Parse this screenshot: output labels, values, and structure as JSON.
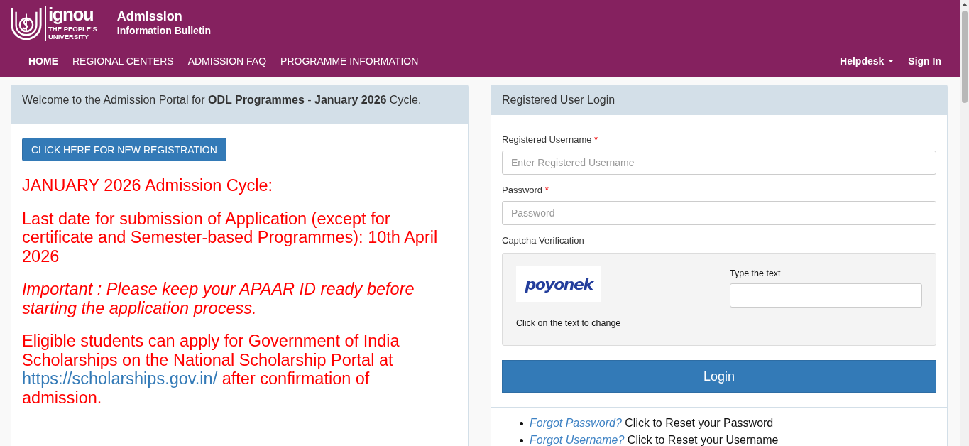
{
  "header": {
    "logo": {
      "wordmark": "ignou",
      "tagline": [
        "THE PEOPLE'S",
        "UNIVERSITY"
      ]
    },
    "title": "Admission",
    "subtitle": "Information Bulletin"
  },
  "nav": {
    "items": [
      {
        "label": "HOME",
        "selected": true
      },
      {
        "label": "REGIONAL CENTERS",
        "selected": false
      },
      {
        "label": "ADMISSION FAQ",
        "selected": false
      },
      {
        "label": "PROGRAMME INFORMATION",
        "selected": false
      }
    ],
    "right_items": [
      {
        "label": "Helpdesk",
        "kind": "dropdown"
      },
      {
        "label": "Sign In",
        "kind": "link"
      }
    ]
  },
  "welcome_panel": {
    "heading": "Welcome to the Admission Portal for **ODL Programmes** - **January 2026** Cycle.",
    "register_button": "CLICK HERE FOR NEW REGISTRATION",
    "notices": [
      {
        "kind": "plain",
        "text": "JANUARY 2026 Admission Cycle:"
      },
      {
        "kind": "plain",
        "text": "Last date for submission of Application (except for certificate and Semester-based Programmes): 10th April 2026"
      },
      {
        "kind": "italic",
        "text": "Important : Please keep your APAAR ID ready before starting the application process."
      },
      {
        "kind": "with_link",
        "text": "Eligible students can apply for Government of India Scholarships on the National Scholarship Portal at",
        "link": "https://scholarships.gov.in/",
        "after": "after confirmation of admission."
      }
    ]
  },
  "login_panel": {
    "title": "Registered User Login",
    "fields": [
      {
        "label": "Registered Username",
        "required_mark": "*",
        "placeholder": "Enter Registered Username"
      },
      {
        "label": "Password",
        "required_mark": "*",
        "placeholder": "Password"
      }
    ],
    "captcha": {
      "label": "Captcha Verification",
      "image_text": "poyonek",
      "hint": "Click on the text to change",
      "input_label": "Type the text"
    },
    "login_button": "Login",
    "help_links": [
      {
        "link": "Forgot Password?",
        "text": "Click to Reset your Password"
      },
      {
        "link": "Forgot Username?",
        "text": "Click to Reset your Username"
      }
    ]
  }
}
